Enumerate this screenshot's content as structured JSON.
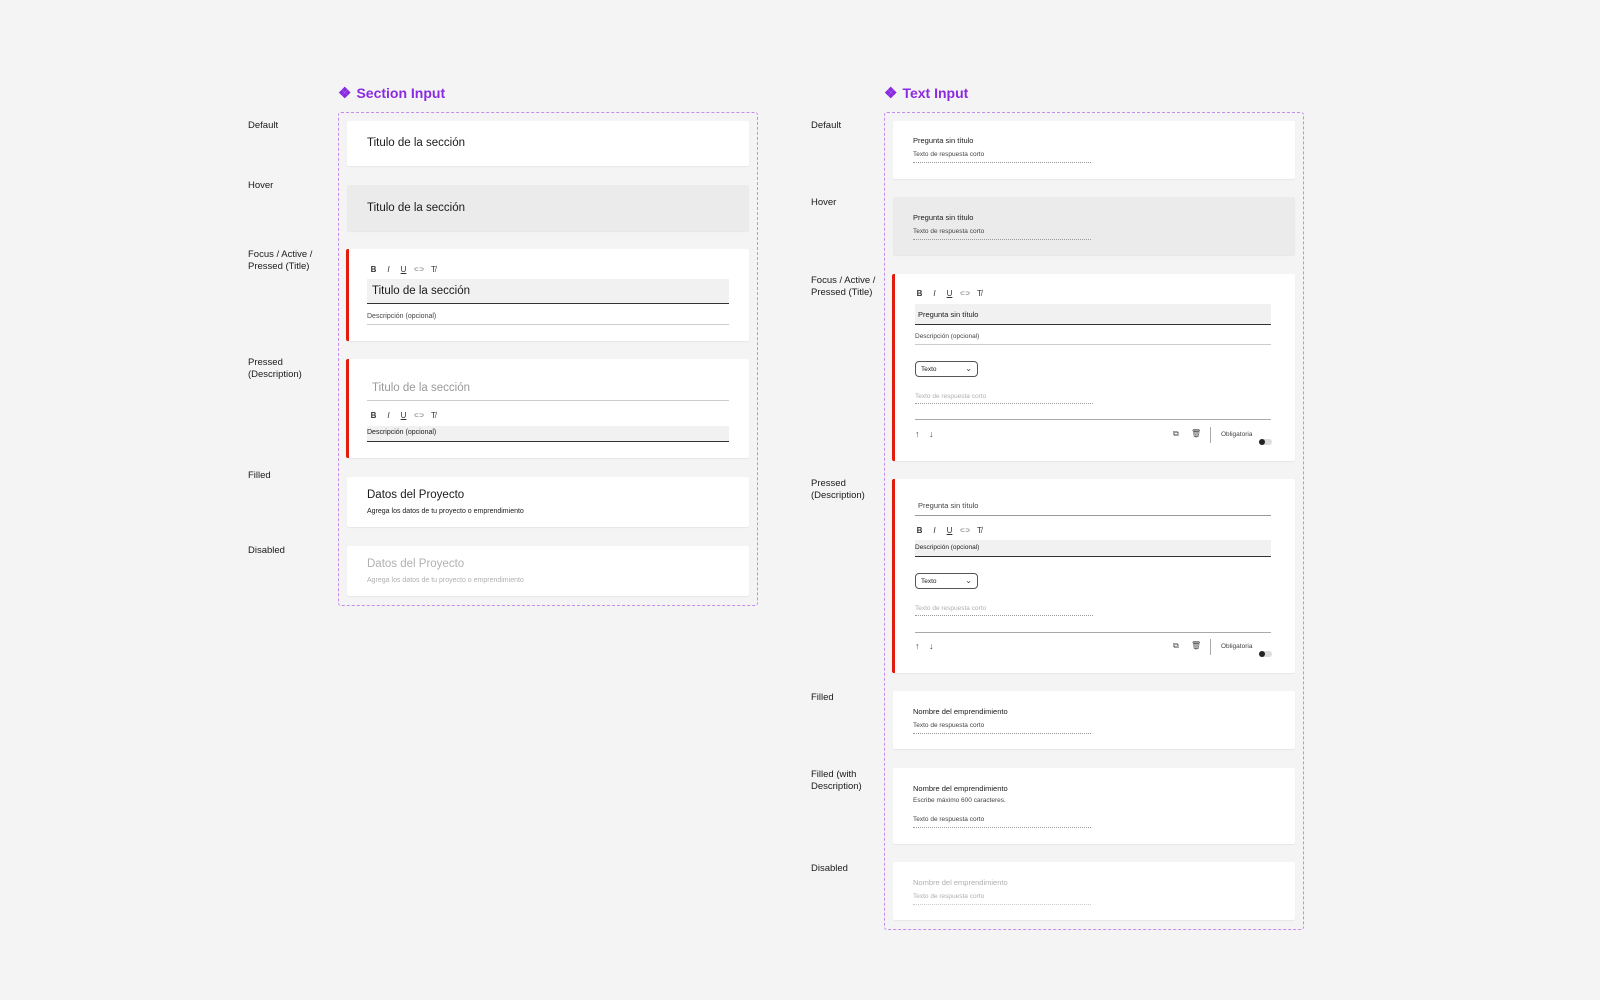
{
  "section_input": {
    "title": "Section Input",
    "states": {
      "default": "Default",
      "hover": "Hover",
      "focus": "Focus / Active / Pressed (Title)",
      "pressed_desc": "Pressed (Description)",
      "filled": "Filled",
      "disabled": "Disabled"
    },
    "title_placeholder": "Titulo de la sección",
    "description_placeholder": "Descripción (opcional)",
    "filled_title": "Datos del Proyecto",
    "filled_description": "Agrega los datos de tu proyecto o emprendimiento"
  },
  "text_input": {
    "title": "Text Input",
    "states": {
      "default": "Default",
      "hover": "Hover",
      "focus": "Focus / Active / Pressed (Title)",
      "pressed_desc": "Pressed (Description)",
      "filled": "Filled",
      "filled_desc": "Filled (with Description)",
      "disabled": "Disabled"
    },
    "question_placeholder": "Pregunta sin título",
    "answer_placeholder": "Texto de respuesta corto",
    "description_placeholder": "Descripción (opcional)",
    "dropdown_value": "Texto",
    "required_label": "Obligatoria",
    "filled_question": "Nombre del emprendimiento",
    "filled_description": "Escribe máximo 600 caracteres."
  },
  "toolbar": {
    "bold": "B",
    "italic": "I",
    "underline": "U",
    "link": "⊂⊃",
    "clear_format": "T̸"
  },
  "colors": {
    "accent": "#8a2be2",
    "active_bar": "#e31b0c",
    "hover_bg": "#ebebec",
    "page_bg": "#f4f4f4"
  }
}
